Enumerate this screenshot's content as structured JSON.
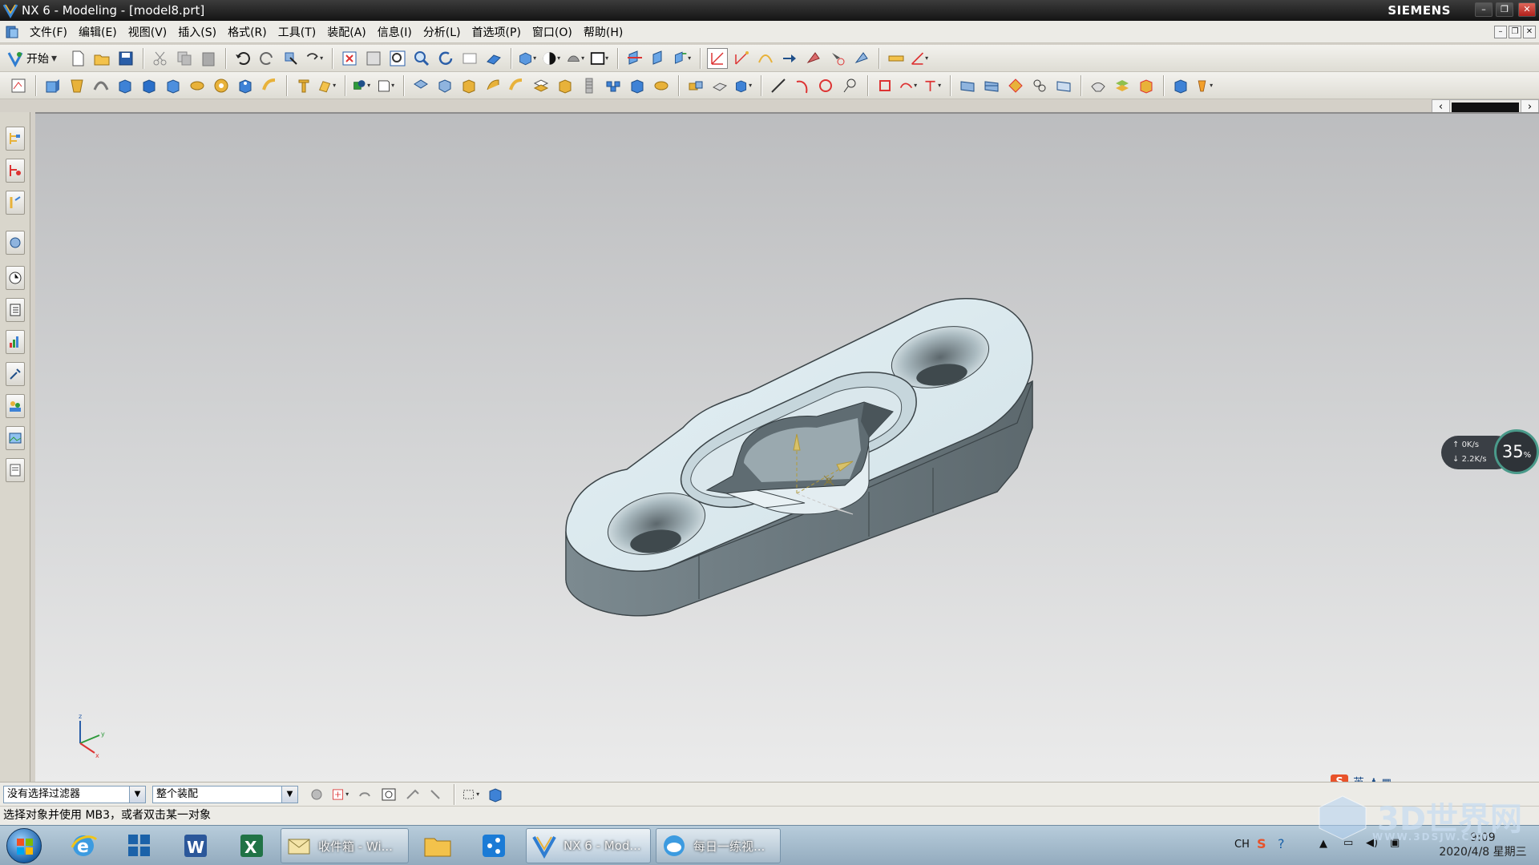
{
  "window": {
    "title": "NX 6 - Modeling - [model8.prt]",
    "brand": "SIEMENS"
  },
  "menu": {
    "items": [
      "文件(F)",
      "编辑(E)",
      "视图(V)",
      "插入(S)",
      "格式(R)",
      "工具(T)",
      "装配(A)",
      "信息(I)",
      "分析(L)",
      "首选项(P)",
      "窗口(O)",
      "帮助(H)"
    ]
  },
  "toolbar": {
    "start_label": "开始"
  },
  "selection_bar": {
    "filter_value": "没有选择过滤器",
    "scope_value": "整个装配"
  },
  "status": {
    "prompt": "选择对象并使用 MB3，或者双击某一对象"
  },
  "speed_widget": {
    "percent": "35",
    "percent_unit": "%",
    "upload": "0K/s",
    "download": "2.2K/s"
  },
  "ime": {
    "label": "英"
  },
  "taskbar": {
    "tasks": [
      {
        "label": "收件箱 - Wi..."
      },
      {
        "label": "NX 6 - Mod..."
      },
      {
        "label": "每日一练视..."
      }
    ],
    "tray_lang": "CH",
    "time": "9:09",
    "date": "2020/4/8 星期三"
  },
  "watermark": {
    "text": "3D世界网",
    "sub": "WWW.3DSJW.COM"
  },
  "triad": {
    "x": "x",
    "y": "y",
    "z": "z"
  },
  "colors": {
    "part_top": "#dce9ee",
    "part_side": "#6d7b81",
    "viewport_top": "#bcbdbf",
    "viewport_bottom": "#ebebeb"
  }
}
